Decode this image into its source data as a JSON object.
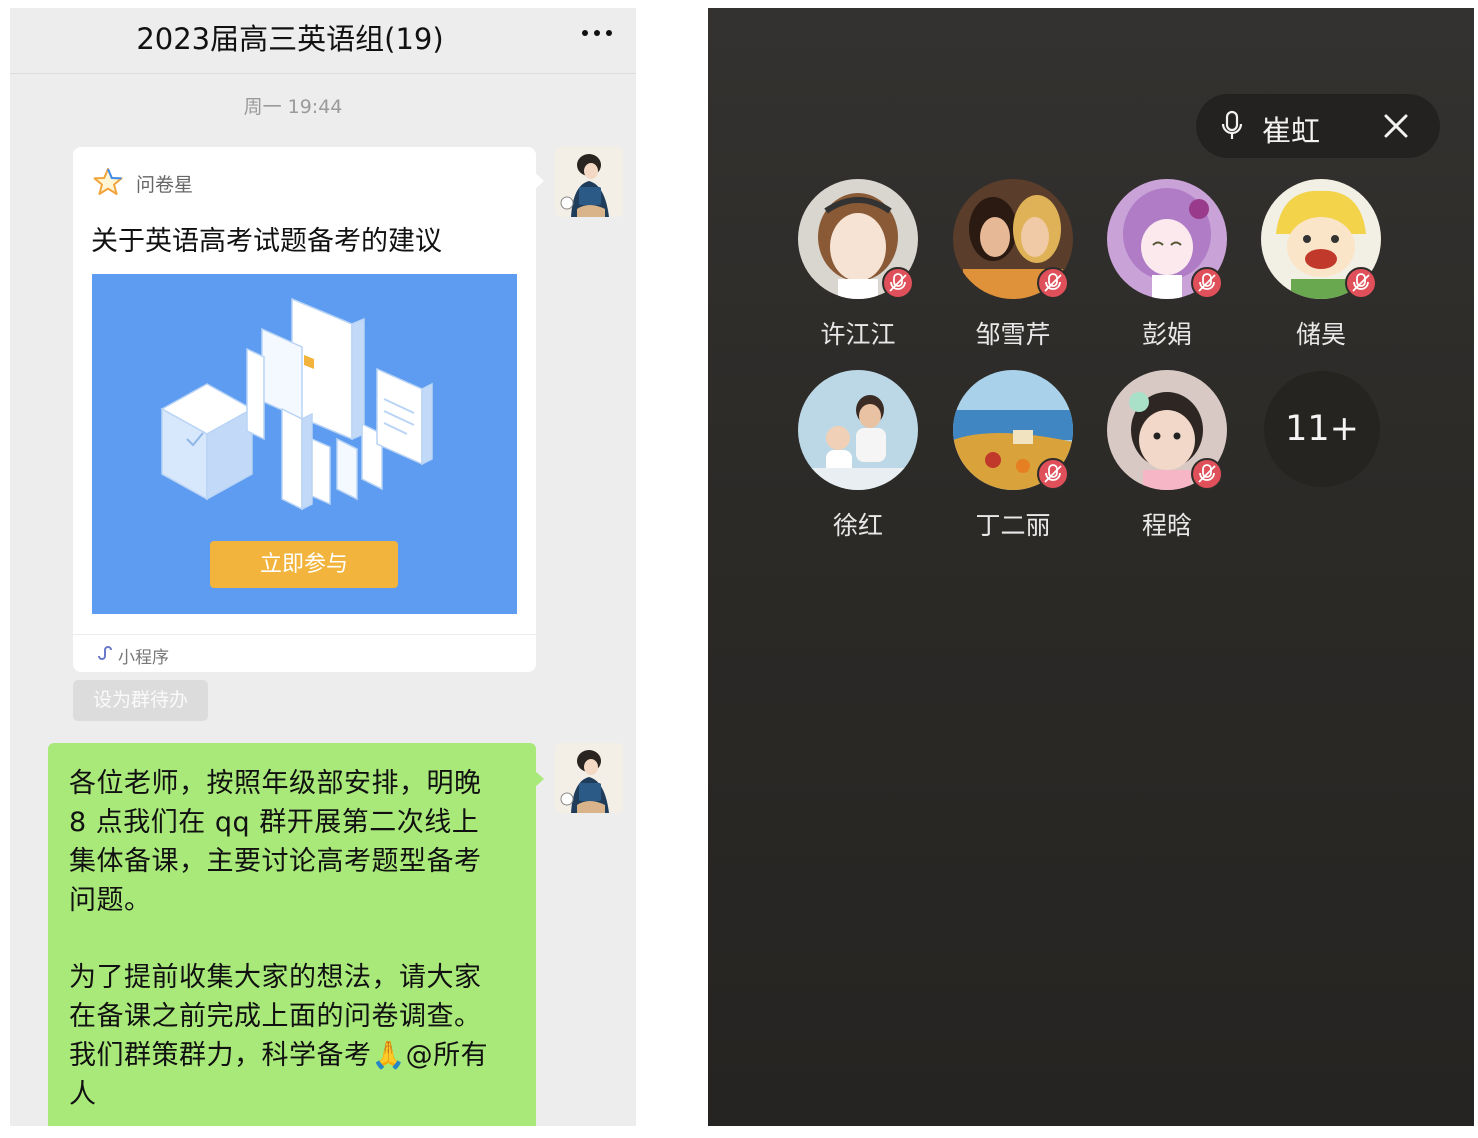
{
  "chat": {
    "title": "2023届高三英语组(19)",
    "more_icon": "ellipsis-icon",
    "timestamp": "周一 19:44",
    "card": {
      "source": "问卷星",
      "source_icon": "star-icon",
      "title": "关于英语高考试题备考的建议",
      "button_label": "立即参与",
      "footer_icon": "miniprogram-icon",
      "footer_label": "小程序"
    },
    "todo_label": "设为群待办",
    "message": {
      "lines": [
        "各位老师，按照年级部安排，明晚",
        "8 点我们在 qq 群开展第二次线上",
        "集体备课，主要讨论高考题型备考",
        "问题。",
        "为了提前收集大家的想法，请大家",
        "在备课之前完成上面的问卷调查。",
        "我们群策群力，科学备考🙏@所有",
        "人"
      ]
    }
  },
  "call": {
    "speaker_name": "崔虹",
    "mic_icon": "microphone-icon",
    "close_icon": "close-icon",
    "participants": [
      {
        "name": "许江江",
        "muted": true
      },
      {
        "name": "邹雪芹",
        "muted": true
      },
      {
        "name": "彭娟",
        "muted": true
      },
      {
        "name": "储昊",
        "muted": true
      },
      {
        "name": "徐红",
        "muted": false
      },
      {
        "name": "丁二丽",
        "muted": true
      },
      {
        "name": "程晗",
        "muted": true
      }
    ],
    "more_count": "11+"
  },
  "colors": {
    "chat_background": "#ededed",
    "bubble_green": "#a9e97a",
    "cover_blue": "#5d9cf0",
    "button_orange": "#f2b43c",
    "call_background": "#2c2a27",
    "mute_red": "#e0505a"
  }
}
